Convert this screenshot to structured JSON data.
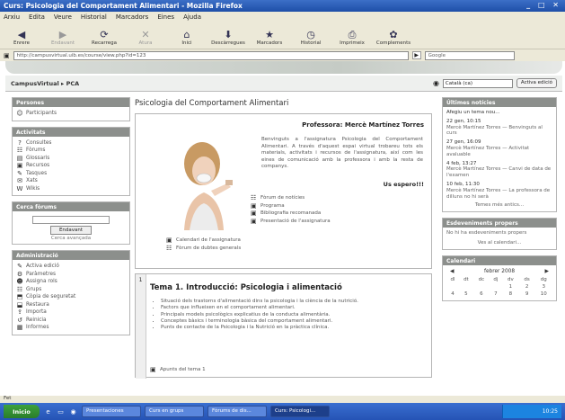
{
  "window": {
    "title": "Curs: Psicologia del Comportament Alimentari - Mozilla Firefox",
    "controls": "_ □ ✕"
  },
  "menu": [
    "Arxiu",
    "Edita",
    "Veure",
    "Historial",
    "Marcadors",
    "Eines",
    "Ajuda"
  ],
  "toolbar": [
    {
      "label": "Enrere",
      "icon": "back-icon",
      "glyph": "◀",
      "dim": false
    },
    {
      "label": "Endavant",
      "icon": "forward-icon",
      "glyph": "▶",
      "dim": true
    },
    {
      "label": "Recarrega",
      "icon": "reload-icon",
      "glyph": "⟳",
      "dim": false
    },
    {
      "label": "Atura",
      "icon": "stop-icon",
      "glyph": "✕",
      "dim": true
    },
    {
      "label": "Inici",
      "icon": "home-icon",
      "glyph": "⌂",
      "dim": false
    },
    {
      "label": "Descàrregues",
      "icon": "download-icon",
      "glyph": "⬇",
      "dim": false
    },
    {
      "label": "Marcadors",
      "icon": "bookmarks-icon",
      "glyph": "★",
      "dim": false
    },
    {
      "label": "Historial",
      "icon": "history-icon",
      "glyph": "◷",
      "dim": false
    },
    {
      "label": "Imprimeix",
      "icon": "print-icon",
      "glyph": "⎙",
      "dim": false
    },
    {
      "label": "Complements",
      "icon": "addons-icon",
      "glyph": "✿",
      "dim": false
    }
  ],
  "address": {
    "url": "http://campusvirtual.uib.es/course/view.php?id=123",
    "search_placeholder": "Google"
  },
  "nav": {
    "breadcrumb": "CampusVirtual ▸ PCA",
    "language": "Català (ca)",
    "edit_button": "Activa edició"
  },
  "left": {
    "participants": {
      "title": "Persones",
      "items": [
        {
          "icon": "people-icon",
          "glyph": "☺",
          "label": "Participants"
        }
      ]
    },
    "activities": {
      "title": "Activitats",
      "items": [
        {
          "icon": "question-icon",
          "glyph": "?",
          "label": "Consultes"
        },
        {
          "icon": "forum-icon",
          "glyph": "☷",
          "label": "Fòrums"
        },
        {
          "icon": "glossary-icon",
          "glyph": "▤",
          "label": "Glossaris"
        },
        {
          "icon": "resource-icon",
          "glyph": "▣",
          "label": "Recursos"
        },
        {
          "icon": "task-icon",
          "glyph": "✎",
          "label": "Tasques"
        },
        {
          "icon": "chat-icon",
          "glyph": "✉",
          "label": "Xats"
        },
        {
          "icon": "wiki-icon",
          "glyph": "W",
          "label": "Wikis"
        }
      ]
    },
    "search": {
      "title": "Cerca fòrums",
      "button": "Endavant",
      "advanced": "Cerca avançada"
    },
    "admin": {
      "title": "Administració",
      "items": [
        {
          "icon": "edit-icon",
          "glyph": "✎",
          "label": "Activa edició"
        },
        {
          "icon": "settings-icon",
          "glyph": "⚙",
          "label": "Paràmetres"
        },
        {
          "icon": "roles-icon",
          "glyph": "☻",
          "label": "Assigna rols"
        },
        {
          "icon": "groups-icon",
          "glyph": "☷",
          "label": "Grups"
        },
        {
          "icon": "backup-icon",
          "glyph": "⬒",
          "label": "Còpia de seguretat"
        },
        {
          "icon": "restore-icon",
          "glyph": "⬓",
          "label": "Restaura"
        },
        {
          "icon": "import-icon",
          "glyph": "⇪",
          "label": "Importa"
        },
        {
          "icon": "reset-icon",
          "glyph": "↺",
          "label": "Reinicia"
        },
        {
          "icon": "reports-icon",
          "glyph": "▦",
          "label": "Informes"
        }
      ]
    }
  },
  "main": {
    "course_title": "Psicologia del Comportament Alimentari",
    "professor": "Professora: Mercè Martínez Torres",
    "welcome": "Benvinguts a l'assignatura Psicologia del Comportament Alimentari. A través d'aquest espai virtual trobareu tots els materials, activitats i recursos de l'assignatura, així com les eines de comunicació amb la professora i amb la resta de companys.",
    "espero": "Us espero!!!",
    "resources": [
      {
        "icon": "forum-icon",
        "glyph": "☷",
        "label": "Fòrum de notícies"
      },
      {
        "icon": "doc-icon",
        "glyph": "▣",
        "label": "Programa"
      },
      {
        "icon": "doc-icon",
        "glyph": "▣",
        "label": "Bibliografia recomanada"
      },
      {
        "icon": "doc-icon",
        "glyph": "▣",
        "label": "Presentació de l'assignatura"
      }
    ],
    "resources2": [
      {
        "icon": "doc-icon",
        "glyph": "▣",
        "label": "Calendari de l'assignatura"
      },
      {
        "icon": "forum-icon",
        "glyph": "☷",
        "label": "Fòrum de dubtes generals"
      }
    ],
    "topic": {
      "number": "1",
      "title": "Tema 1. Introducció: Psicologia i alimentació",
      "bullets": [
        "Situació dels trastorns d'alimentació dins la psicologia i la ciència de la nutrició.",
        "Factors que influeixen en el comportament alimentari.",
        "Principals models psicològics explicatius de la conducta alimentària.",
        "Conceptes bàsics i terminologia bàsica del comportament alimentari.",
        "Punts de contacte de la Psicologia i la Nutrició en la pràctica clínica."
      ],
      "resource": {
        "icon": "doc-icon",
        "glyph": "▣",
        "label": "Apunts del tema 1"
      }
    }
  },
  "right": {
    "news": {
      "title": "Últimes notícies",
      "items": [
        {
          "date": "Afegiu un tema nou...",
          "text": ""
        },
        {
          "date": "22 gen, 10:15",
          "text": "Mercè Martínez Torres — Benvinguts al curs"
        },
        {
          "date": "27 gen, 16:09",
          "text": "Mercè Martínez Torres — Activitat avaluable"
        },
        {
          "date": "4 feb, 13:27",
          "text": "Mercè Martínez Torres — Canvi de data de l'examen"
        },
        {
          "date": "10 feb, 11:30",
          "text": "Mercè Martínez Torres — La professora de dilluns no hi serà"
        }
      ],
      "more": "Temes més antics..."
    },
    "events": {
      "title": "Esdeveniments propers",
      "text": "No hi ha esdeveniments propers",
      "more": "Ves al calendari..."
    },
    "calendar": {
      "title": "Calendari",
      "month": "febrer 2008",
      "days": [
        "dl",
        "dt",
        "dc",
        "dj",
        "dv",
        "ds",
        "dg"
      ],
      "weeks": [
        [
          "",
          "",
          "",
          "",
          "1",
          "2",
          "3"
        ],
        [
          "4",
          "5",
          "6",
          "7",
          "8",
          "9",
          "10"
        ]
      ]
    }
  },
  "status": {
    "text": "Fet"
  },
  "taskbar": {
    "start": "Inicio",
    "tasks": [
      "Presentaciones",
      "Curs en grups",
      "Fòrums de dis...",
      "Curs: Psicologi..."
    ],
    "active": 3,
    "clock": "10:25"
  }
}
